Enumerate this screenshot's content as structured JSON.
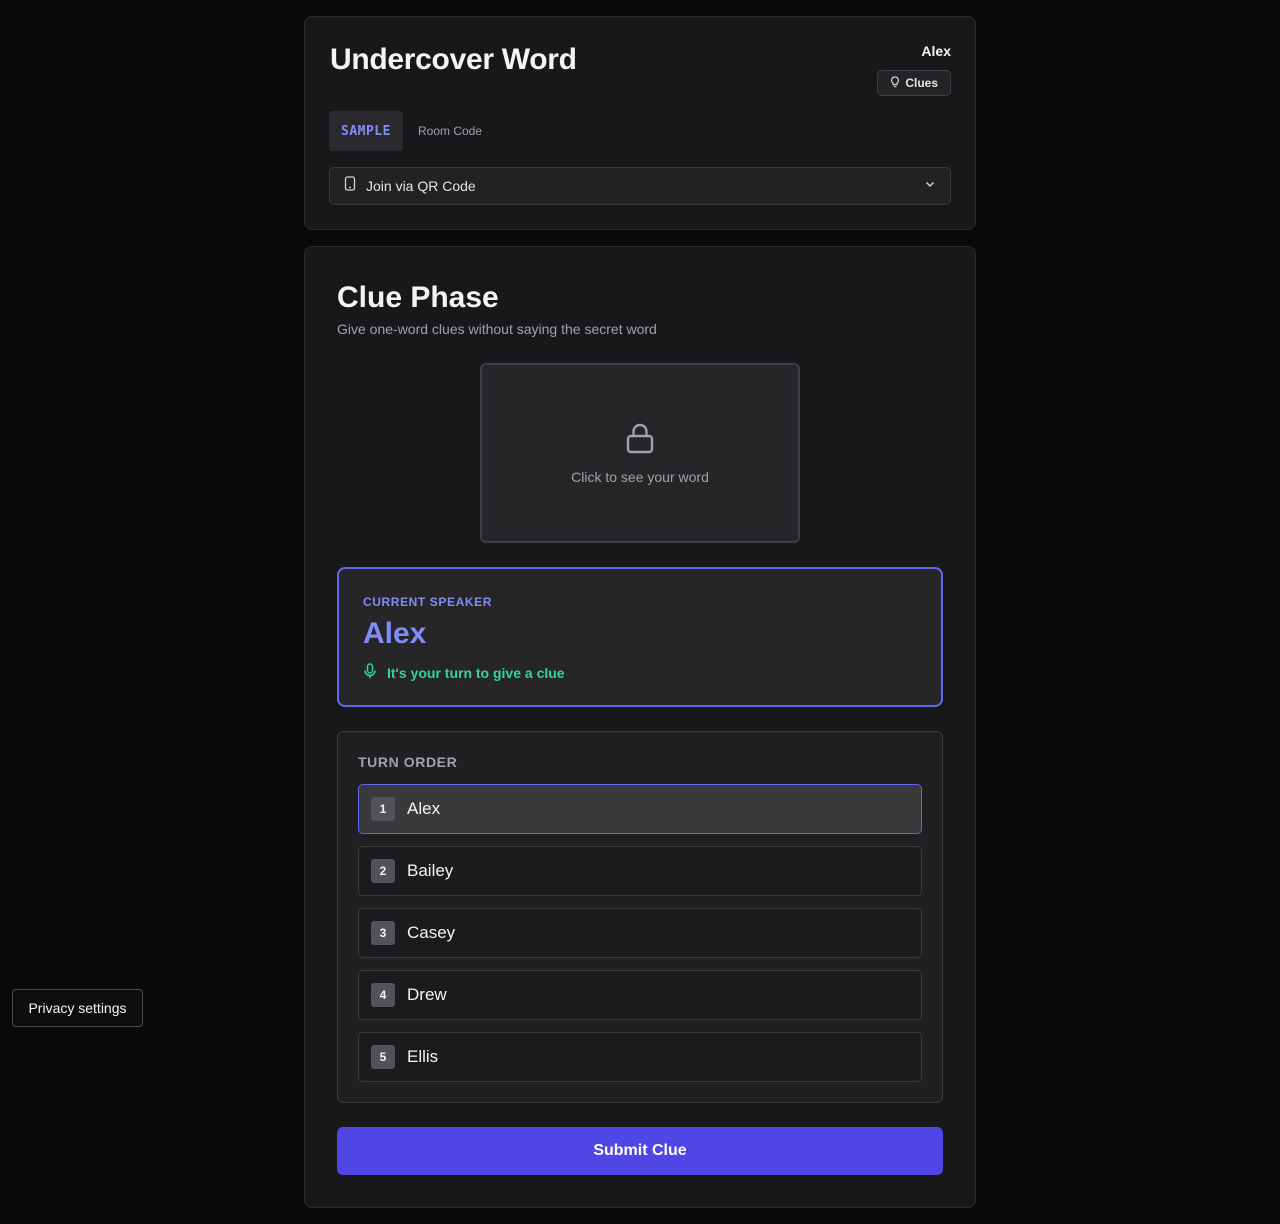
{
  "header": {
    "title": "Undercover Word",
    "player_name": "Alex",
    "clues_button": "Clues",
    "room_code": "SAMPLE",
    "room_code_label": "Room Code",
    "qr_toggle_label": "Join via QR Code"
  },
  "phase": {
    "title": "Clue Phase",
    "subtitle": "Give one-word clues without saying the secret word",
    "word_reveal_hint": "Click to see your word"
  },
  "speaker": {
    "label": "CURRENT SPEAKER",
    "name": "Alex",
    "status": "It's your turn to give a clue"
  },
  "turn_order": {
    "title": "TURN ORDER",
    "players": [
      {
        "num": "1",
        "name": "Alex",
        "active": true
      },
      {
        "num": "2",
        "name": "Bailey",
        "active": false
      },
      {
        "num": "3",
        "name": "Casey",
        "active": false
      },
      {
        "num": "4",
        "name": "Drew",
        "active": false
      },
      {
        "num": "5",
        "name": "Ellis",
        "active": false
      }
    ]
  },
  "submit_button": "Submit Clue",
  "privacy_button": "Privacy settings",
  "colors": {
    "accent": "#6366f1",
    "accent_text": "#818cf8",
    "submit": "#4f46e5",
    "status_green": "#34d399",
    "background": "#0a0a0a",
    "card": "#18181a"
  },
  "icons": {
    "clues": "lightbulb-icon",
    "qr": "phone-icon",
    "qr_toggle": "chevron-down-icon",
    "word_reveal": "lock-icon",
    "speaker_status": "microphone-icon"
  }
}
